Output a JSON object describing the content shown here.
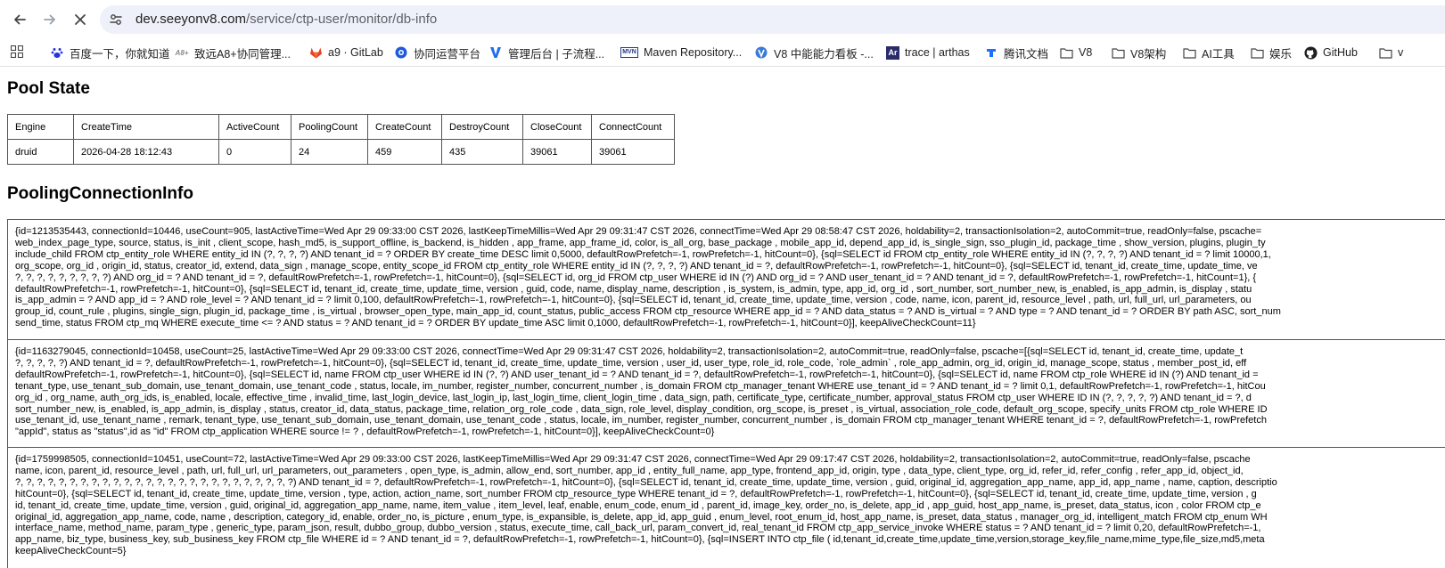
{
  "browser": {
    "url_host": "dev.seeyonv8.com",
    "url_path": "/service/ctp-user/monitor/db-info",
    "bookmarks": [
      {
        "label": "百度一下，你就知道",
        "icon": "baidu-paw-icon"
      },
      {
        "label": "致远A8+协同管理...",
        "icon": "seeyon-a8-icon"
      },
      {
        "label": "a9 · GitLab",
        "icon": "gitlab-fox-icon"
      },
      {
        "label": "协同运营平台",
        "icon": "cooperation-platform-icon"
      },
      {
        "label": "管理后台 | 子流程...",
        "icon": "v-logo-icon"
      },
      {
        "label": "Maven Repository...",
        "icon": "maven-icon"
      },
      {
        "label": "V8 中能能力看板 -...",
        "icon": "v8-leaf-icon"
      },
      {
        "label": "trace | arthas",
        "icon": "arthas-icon"
      },
      {
        "label": "腾讯文档",
        "icon": "tencent-docs-icon"
      },
      {
        "label": "V8",
        "icon": "folder-icon"
      },
      {
        "label": "V8架构",
        "icon": "folder-icon"
      },
      {
        "label": "AI工具",
        "icon": "folder-icon"
      },
      {
        "label": "娱乐",
        "icon": "folder-icon"
      },
      {
        "label": "GitHub",
        "icon": "github-icon"
      },
      {
        "label": "v",
        "icon": "folder-icon"
      }
    ]
  },
  "pool_state": {
    "title": "Pool State",
    "headers": [
      "Engine",
      "CreateTime",
      "ActiveCount",
      "PoolingCount",
      "CreateCount",
      "DestroyCount",
      "CloseCount",
      "ConnectCount"
    ],
    "rows": [
      [
        "druid",
        "2026-04-28 18:12:43",
        "0",
        "24",
        "459",
        "435",
        "39061",
        "39061"
      ]
    ]
  },
  "pooling": {
    "title": "PoolingConnectionInfo",
    "rows": [
      [
        "{id=1213535443, connectionId=10446, useCount=905, lastActiveTime=Wed Apr 29 09:33:00 CST 2026, lastKeepTimeMillis=Wed Apr 29 09:31:47 CST 2026, connectTime=Wed Apr 29 08:58:47 CST 2026, holdability=2, transactionIsolation=2, autoCommit=true, readOnly=false, pscache=",
        "web_index_page_type, source, status, is_init , client_scope, hash_md5, is_support_offline, is_backend, is_hidden , app_frame, app_frame_id, color, is_all_org, base_package , mobile_app_id, depend_app_id, is_single_sign, sso_plugin_id, package_time , show_version, plugins, plugin_ty",
        "include_child FROM ctp_entity_role WHERE entity_id IN (?, ?, ?, ?) AND tenant_id = ? ORDER BY create_time DESC limit 0,5000, defaultRowPrefetch=-1, rowPrefetch=-1, hitCount=0}, {sql=SELECT id FROM ctp_entity_role WHERE entity_id IN (?, ?, ?, ?) AND tenant_id = ? limit 10000,1,",
        "org_scope, org_id , origin_id, status, creator_id, extend, data_sign , manage_scope, entity_scope_id FROM ctp_entity_role WHERE entity_id IN (?, ?, ?, ?) AND tenant_id = ?, defaultRowPrefetch=-1, rowPrefetch=-1, hitCount=0}, {sql=SELECT id, tenant_id, create_time, update_time, ve",
        "?, ?, ?, ?, ?, ?, ?, ?, ?) AND org_id = ? AND tenant_id = ?, defaultRowPrefetch=-1, rowPrefetch=-1, hitCount=0}, {sql=SELECT id, org_id FROM ctp_user WHERE id IN (?) AND org_id = ? AND user_tenant_id = ? AND tenant_id = ?, defaultRowPrefetch=-1, rowPrefetch=-1, hitCount=1}, {",
        "defaultRowPrefetch=-1, rowPrefetch=-1, hitCount=0}, {sql=SELECT id, tenant_id, create_time, update_time, version , guid, code, name, display_name, description , is_system, is_admin, type, app_id, org_id , sort_number, sort_number_new, is_enabled, is_app_admin, is_display , statu",
        "is_app_admin = ? AND app_id = ? AND role_level = ? AND tenant_id = ? limit 0,100, defaultRowPrefetch=-1, rowPrefetch=-1, hitCount=0}, {sql=SELECT id, tenant_id, create_time, update_time, version , code, name, icon, parent_id, resource_level , path, url, full_url, url_parameters, ou",
        "group_id, count_rule , plugins, single_sign, plugin_id, package_time , is_virtual , browser_open_type, main_app_id, count_status, public_access FROM ctp_resource WHERE app_id = ? AND data_status = ? AND is_virtual = ? AND type = ? AND tenant_id = ? ORDER BY path ASC, sort_num",
        "send_time, status FROM ctp_mq WHERE execute_time <= ? AND status = ? AND tenant_id = ? ORDER BY update_time ASC limit 0,1000, defaultRowPrefetch=-1, rowPrefetch=-1, hitCount=0}], keepAliveCheckCount=11}"
      ],
      [
        "{id=1163279045, connectionId=10458, useCount=25, lastActiveTime=Wed Apr 29 09:33:00 CST 2026, connectTime=Wed Apr 29 09:31:47 CST 2026, holdability=2, transactionIsolation=2, autoCommit=true, readOnly=false, pscache=[{sql=SELECT id, tenant_id, create_time, update_t",
        "?, ?, ?, ?, ?) AND tenant_id = ?, defaultRowPrefetch=-1, rowPrefetch=-1, hitCount=0}, {sql=SELECT id, tenant_id, create_time, update_time, version , user_id, user_type, role_id, role_code, `role_admin` , role_app_admin, org_id, origin_id, manage_scope, status , member_post_id, eff",
        "defaultRowPrefetch=-1, rowPrefetch=-1, hitCount=0}, {sql=SELECT id, name FROM ctp_user WHERE id IN (?, ?) AND user_tenant_id = ? AND tenant_id = ?, defaultRowPrefetch=-1, rowPrefetch=-1, hitCount=0}, {sql=SELECT id, name FROM ctp_role WHERE id IN (?) AND tenant_id = ",
        "tenant_type, use_tenant_sub_domain, use_tenant_domain, use_tenant_code , status, locale, im_number, register_number, concurrent_number , is_domain FROM ctp_manager_tenant WHERE use_tenant_id = ? AND tenant_id = ? limit 0,1, defaultRowPrefetch=-1, rowPrefetch=-1, hitCou",
        "org_id , org_name, auth_org_ids, is_enabled, locale, effective_time , invalid_time, last_login_device, last_login_ip, last_login_time, client_login_time , data_sign, path, certificate_type, certificate_number, approval_status FROM ctp_user WHERE ID IN (?, ?, ?, ?, ?) AND tenant_id = ?, d",
        "sort_number_new, is_enabled, is_app_admin, is_display , status, creator_id, data_status, package_time, relation_org_role_code , data_sign, role_level, display_condition, org_scope, is_preset , is_virtual, association_role_code, default_org_scope, specify_units FROM ctp_role WHERE ID",
        "use_tenant_id, use_tenant_name , remark, tenant_type, use_tenant_sub_domain, use_tenant_domain, use_tenant_code , status, locale, im_number, register_number, concurrent_number , is_domain FROM ctp_manager_tenant WHERE tenant_id = ?, defaultRowPrefetch=-1, rowPrefetch",
        "\"appId\", status as \"status\",id as \"id\" FROM ctp_application WHERE source != ? , defaultRowPrefetch=-1, rowPrefetch=-1, hitCount=0}], keepAliveCheckCount=0}"
      ],
      [
        "{id=1759998505, connectionId=10451, useCount=72, lastActiveTime=Wed Apr 29 09:33:00 CST 2026, lastKeepTimeMillis=Wed Apr 29 09:31:47 CST 2026, connectTime=Wed Apr 29 09:17:47 CST 2026, holdability=2, transactionIsolation=2, autoCommit=true, readOnly=false, pscache",
        "name, icon, parent_id, resource_level , path, url, full_url, url_parameters, out_parameters , open_type, is_admin, allow_end, sort_number, app_id , entity_full_name, app_type, frontend_app_id, origin, type , data_type, client_type, org_id, refer_id, refer_config , refer_app_id, object_id,",
        "?, ?, ?, ?, ?, ?, ?, ?, ?, ?, ?, ?, ?, ?, ?, ?, ?, ?, ?, ?, ?, ?, ?, ?, ?, ?) AND tenant_id = ?, defaultRowPrefetch=-1, rowPrefetch=-1, hitCount=0}, {sql=SELECT id, tenant_id, create_time, update_time, version , guid, original_id, aggregation_app_name, app_id, app_name , name, caption, descriptio",
        "hitCount=0}, {sql=SELECT id, tenant_id, create_time, update_time, version , type, action, action_name, sort_number FROM ctp_resource_type WHERE tenant_id = ?, defaultRowPrefetch=-1, rowPrefetch=-1, hitCount=0}, {sql=SELECT id, tenant_id, create_time, update_time, version , g",
        "id, tenant_id, create_time, update_time, version , guid, original_id, aggregation_app_name, name, item_value , item_level, leaf, enable, enum_code, enum_id , parent_id, image_key, order_no, is_delete, app_id , app_guid, host_app_name, is_preset, data_status, icon , color FROM ctp_e",
        "original_id, aggregation_app_name, code, name , description, category_id, enable, order_no, is_picture , enum_type, is_expansible, is_delete, app_id, app_guid , enum_level, root_enum_id, host_app_name, is_preset, data_status , manager_org_id, intelligent_match FROM ctp_enum WH",
        "interface_name, method_name, param_type , generic_type, param_json, result, dubbo_group, dubbo_version , status, execute_time, call_back_url, param_convert_id, real_tenant_id FROM ctp_app_service_invoke WHERE status = ? AND tenant_id = ? limit 0,20, defaultRowPrefetch=-1,",
        "app_name, biz_type, business_key, sub_business_key FROM ctp_file WHERE id = ? AND tenant_id = ?, defaultRowPrefetch=-1, rowPrefetch=-1, hitCount=0}, {sql=INSERT INTO ctp_file ( id,tenant_id,create_time,update_time,version,storage_key,file_name,mime_type,file_size,md5,meta",
        "keepAliveCheckCount=5}"
      ]
    ]
  }
}
